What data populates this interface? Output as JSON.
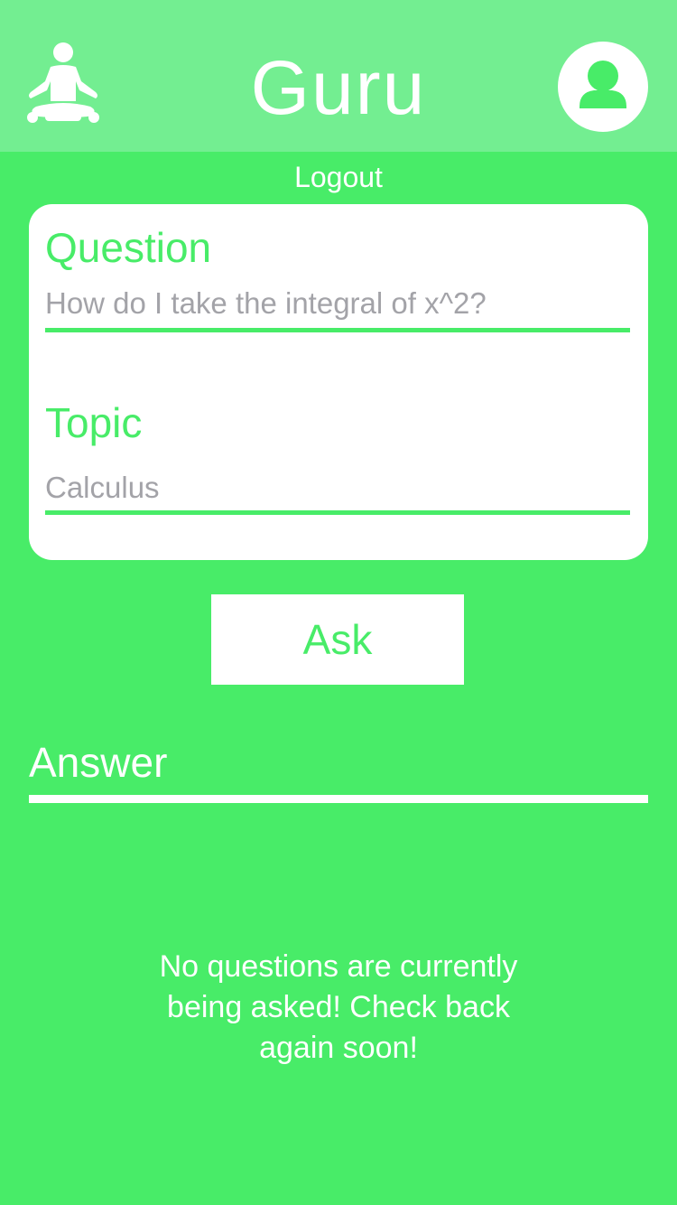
{
  "header": {
    "title": "Guru",
    "left_icon": "meditation-icon",
    "right_icon": "profile-avatar-icon"
  },
  "logout_label": "Logout",
  "question_form": {
    "question_label": "Question",
    "question_placeholder": "How do I take the integral of x^2?",
    "topic_label": "Topic",
    "topic_placeholder": "Calculus"
  },
  "ask_button_label": "Ask",
  "answer": {
    "label": "Answer",
    "empty_message": "No questions are currently being asked! Check back again soon!"
  },
  "colors": {
    "background": "#48ec68",
    "header_background": "#73ee91",
    "accent": "#48ec68",
    "placeholder": "#a3a3a8",
    "surface": "#ffffff"
  }
}
